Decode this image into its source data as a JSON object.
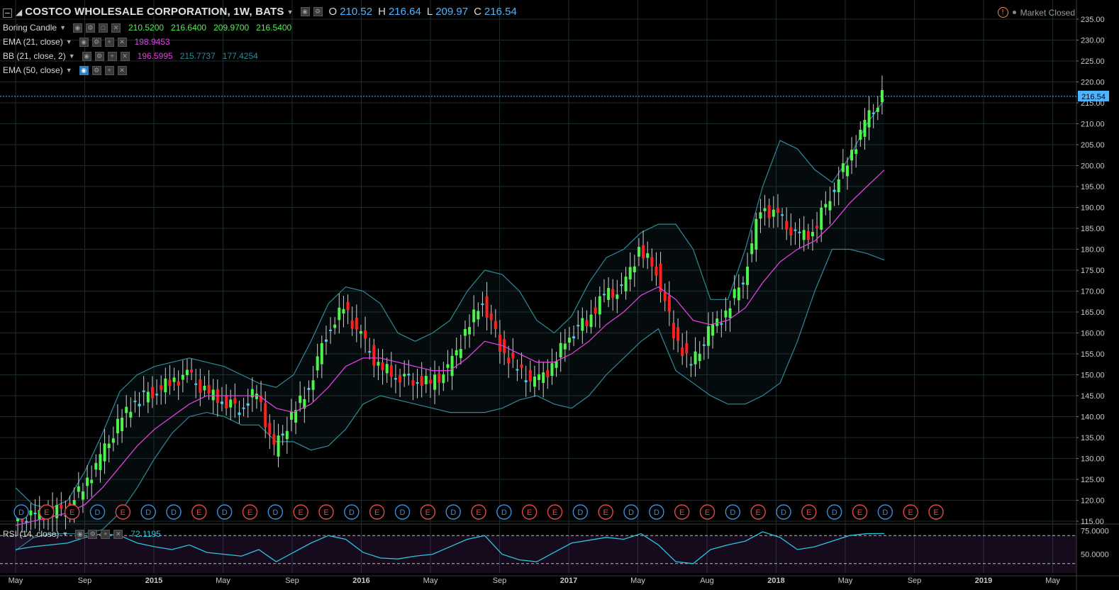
{
  "header": {
    "symbol_title": "COSTCO WHOLESALE CORPORATION, 1W, BATS",
    "ohlc": {
      "o_label": "O",
      "o": "210.52",
      "h_label": "H",
      "h": "216.64",
      "l_label": "L",
      "l": "209.97",
      "c_label": "C",
      "c": "216.54"
    },
    "market_status": "Market Closed",
    "warn_glyph": "!"
  },
  "legends": {
    "candle": {
      "name": "Boring Candle",
      "values": [
        "210.5200",
        "216.6400",
        "209.9700",
        "216.5400"
      ],
      "color": "#4cf44c"
    },
    "ema21": {
      "name": "EMA (21, close)",
      "value": "198.9453",
      "color": "#e040e0"
    },
    "bb": {
      "name": "BB (21, close, 2)",
      "values": [
        "196.5995",
        "215.7737",
        "177.4254"
      ],
      "colors": [
        "#e040e0",
        "#2e8a9a",
        "#2e8a9a"
      ]
    },
    "ema50": {
      "name": "EMA (50, close)"
    },
    "rsi": {
      "name": "RSI (14, close)",
      "value": "72.1195"
    }
  },
  "price_axis": {
    "ticks": [
      "235.00",
      "230.00",
      "225.00",
      "220.00",
      "215.00",
      "210.00",
      "205.00",
      "200.00",
      "195.00",
      "190.00",
      "185.00",
      "180.00",
      "175.00",
      "170.00",
      "165.00",
      "160.00",
      "155.00",
      "150.00",
      "145.00",
      "140.00",
      "135.00",
      "130.00",
      "125.00",
      "120.00",
      "115.00"
    ],
    "last_price_label": "216.54"
  },
  "rsi_axis": {
    "ticks": [
      "75.0000",
      "50.0000"
    ]
  },
  "time_axis": {
    "labels": [
      "May",
      "Sep",
      "2015",
      "May",
      "Sep",
      "2016",
      "May",
      "Sep",
      "2017",
      "May",
      "Aug",
      "2018",
      "May",
      "Sep",
      "2019",
      "May"
    ]
  },
  "event_markers": [
    "D",
    "E",
    "E",
    "D",
    "E",
    "D",
    "D",
    "E",
    "D",
    "E",
    "D",
    "E",
    "E",
    "D",
    "E",
    "D",
    "E",
    "D",
    "E",
    "D",
    "E",
    "E",
    "D",
    "E",
    "D",
    "D",
    "E",
    "E",
    "D",
    "E",
    "D",
    "E",
    "D",
    "E",
    "D",
    "E",
    "E"
  ],
  "colors": {
    "up": "#4cf44c",
    "down": "#ff2020",
    "neutral": "#40d4f4",
    "ema": "#e040e0",
    "bb": "#2e8a9a",
    "grid": "#1d2b2b",
    "bg": "#000000",
    "rsi": "#2cc6dc"
  },
  "chart_data": {
    "type": "candlestick",
    "title": "COSTCO WHOLESALE CORPORATION, 1W, BATS",
    "ylim": [
      115,
      235
    ],
    "x": [
      "2014-05",
      "2014-06",
      "2014-07",
      "2014-08",
      "2014-09",
      "2014-10",
      "2014-11",
      "2014-12",
      "2015-01",
      "2015-02",
      "2015-03",
      "2015-04",
      "2015-05",
      "2015-06",
      "2015-07",
      "2015-08",
      "2015-09",
      "2015-10",
      "2015-11",
      "2015-12",
      "2016-01",
      "2016-02",
      "2016-03",
      "2016-04",
      "2016-05",
      "2016-06",
      "2016-07",
      "2016-08",
      "2016-09",
      "2016-10",
      "2016-11",
      "2016-12",
      "2017-01",
      "2017-02",
      "2017-03",
      "2017-04",
      "2017-05",
      "2017-06",
      "2017-07",
      "2017-08",
      "2017-09",
      "2017-10",
      "2017-11",
      "2017-12",
      "2018-01",
      "2018-02",
      "2018-03",
      "2018-04",
      "2018-05",
      "2018-06",
      "2018-07"
    ],
    "close": [
      115,
      116,
      117,
      118,
      123,
      130,
      138,
      144,
      146,
      148,
      150,
      146,
      144,
      142,
      146,
      132,
      140,
      147,
      160,
      166,
      159,
      152,
      150,
      149,
      148,
      151,
      160,
      168,
      157,
      151,
      148,
      152,
      160,
      163,
      169,
      170,
      180,
      175,
      160,
      152,
      160,
      165,
      173,
      190,
      188,
      183,
      184,
      193,
      201,
      210,
      216.54
    ],
    "ema21": [
      114,
      115,
      116,
      117,
      119,
      123,
      128,
      133,
      137,
      140,
      143,
      145,
      145,
      145,
      145,
      142,
      141,
      143,
      147,
      152,
      154,
      154,
      153,
      152,
      151,
      151,
      154,
      158,
      157,
      155,
      153,
      153,
      155,
      158,
      162,
      165,
      169,
      171,
      168,
      163,
      162,
      163,
      166,
      172,
      177,
      180,
      182,
      186,
      191,
      195,
      198.95
    ],
    "bb_upper": [
      123,
      119,
      118,
      120,
      127,
      136,
      146,
      150,
      152,
      153,
      154,
      153,
      152,
      150,
      148,
      147,
      150,
      158,
      167,
      171,
      170,
      167,
      160,
      158,
      160,
      163,
      170,
      175,
      174,
      170,
      163,
      160,
      164,
      172,
      178,
      180,
      184,
      186,
      186,
      180,
      168,
      168,
      180,
      195,
      206,
      204,
      199,
      196,
      202,
      210,
      215.77
    ],
    "bb_lower": [
      108,
      111,
      112,
      112,
      112,
      113,
      117,
      123,
      130,
      136,
      140,
      141,
      140,
      138,
      138,
      134,
      134,
      132,
      133,
      137,
      143,
      145,
      144,
      143,
      142,
      141,
      141,
      141,
      142,
      144,
      145,
      143,
      142,
      145,
      150,
      154,
      158,
      161,
      151,
      148,
      145,
      143,
      143,
      145,
      148,
      158,
      170,
      180,
      180,
      179,
      177.43
    ],
    "rsi_ylim": [
      30,
      80
    ],
    "rsi": [
      55,
      58,
      60,
      62,
      68,
      72,
      70,
      62,
      58,
      55,
      60,
      52,
      50,
      48,
      55,
      42,
      52,
      62,
      70,
      66,
      52,
      46,
      45,
      48,
      50,
      58,
      66,
      70,
      50,
      44,
      42,
      52,
      62,
      65,
      68,
      66,
      72,
      60,
      42,
      40,
      55,
      60,
      64,
      74,
      68,
      55,
      58,
      64,
      70,
      72,
      72.12
    ]
  }
}
